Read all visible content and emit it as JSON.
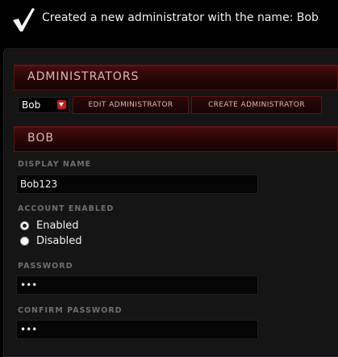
{
  "notification": {
    "icon": "checkmark-icon",
    "message": "Created a new administrator with the name: Bob"
  },
  "admins_section": {
    "title": "ADMINISTRATORS",
    "selected_admin": "Bob",
    "edit_button": "EDIT ADMINISTRATOR",
    "create_button": "CREATE ADMINISTRATOR"
  },
  "admin_section": {
    "title": "BOB",
    "display_name_label": "DISPLAY NAME",
    "display_name_value": "Bob123",
    "account_enabled_label": "ACCOUNT ENABLED",
    "enabled_option": "Enabled",
    "disabled_option": "Disabled",
    "selected_option": "Enabled",
    "password_label": "PASSWORD",
    "password_value": "•••",
    "confirm_password_label": "CONFIRM PASSWORD",
    "confirm_password_value": "•••"
  },
  "colors": {
    "accent": "#c41d1d",
    "header_bg": "#3a0909",
    "page_bg": "#000000",
    "panel_bg": "#151516"
  }
}
